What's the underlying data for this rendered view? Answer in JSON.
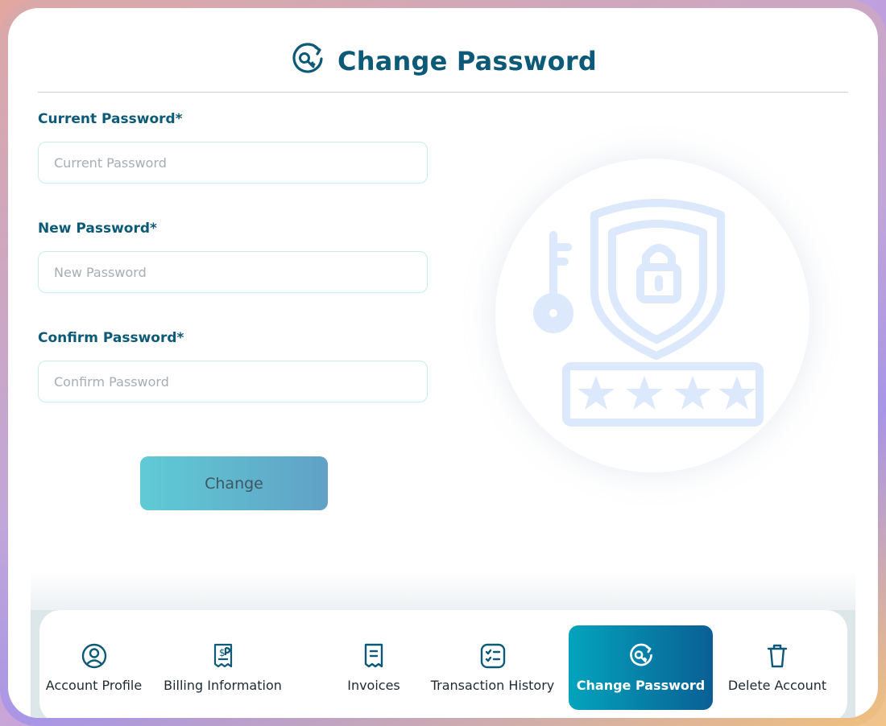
{
  "header": {
    "title": "Change Password",
    "icon": "key-refresh-icon"
  },
  "form": {
    "current": {
      "label": "Current Password*",
      "placeholder": "Current Password",
      "value": ""
    },
    "new": {
      "label": "New Password*",
      "placeholder": "New Password",
      "value": ""
    },
    "confirm": {
      "label": "Confirm Password*",
      "placeholder": "Confirm Password",
      "value": ""
    },
    "submit_label": "Change"
  },
  "illustration": {
    "icon": "shield-lock-password-icon"
  },
  "nav": {
    "items": [
      {
        "label": "Account Profile",
        "icon": "user-circle-icon",
        "active": false
      },
      {
        "label": "Billing Information",
        "icon": "receipt-dollar-icon",
        "active": false
      },
      {
        "label": "Invoices",
        "icon": "invoice-icon",
        "active": false
      },
      {
        "label": "Transaction History",
        "icon": "checklist-icon",
        "active": false
      },
      {
        "label": "Change Password",
        "icon": "key-refresh-icon",
        "active": true
      },
      {
        "label": "Delete Account",
        "icon": "trash-icon",
        "active": false
      }
    ]
  },
  "colors": {
    "primary_text": "#0d5a78",
    "active_nav_start": "#03a4bd",
    "active_nav_end": "#0a5f94",
    "button_start": "#5fcbd5",
    "button_end": "#61a1c6"
  }
}
